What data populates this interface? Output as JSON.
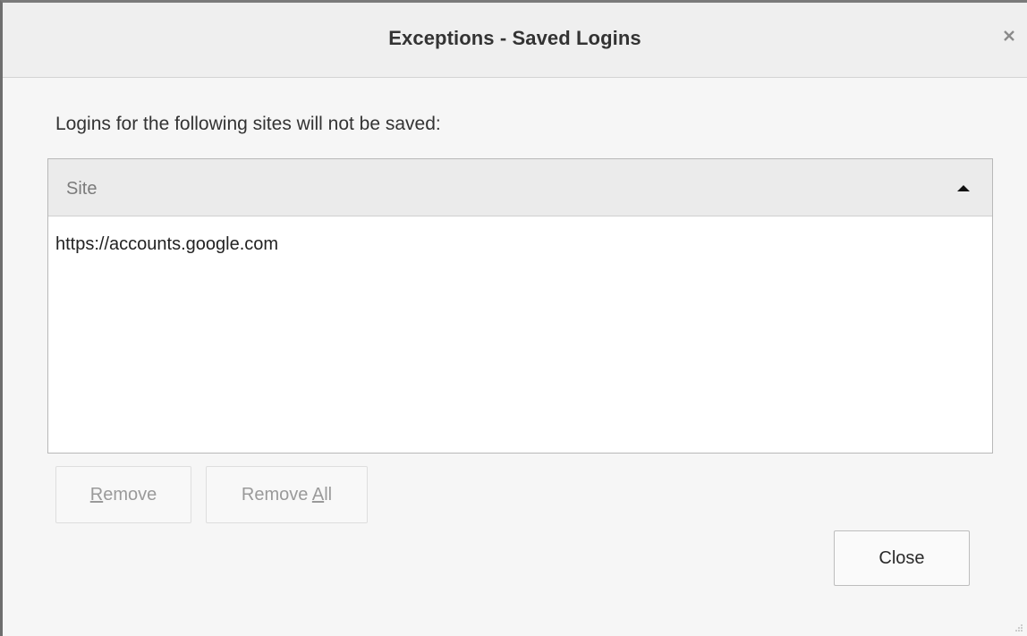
{
  "dialog": {
    "title": "Exceptions - Saved Logins",
    "close_glyph": "×",
    "intro": "Logins for the following sites will not be saved:"
  },
  "table": {
    "column_site": "Site",
    "sort_direction": "ascending",
    "rows": [
      {
        "site": "https://accounts.google.com"
      }
    ]
  },
  "buttons": {
    "remove": {
      "accesskey": "R",
      "rest": "emove",
      "enabled": false
    },
    "remove_all": {
      "prefix": "Remove ",
      "accesskey": "A",
      "rest": "ll",
      "enabled": false
    },
    "close": "Close"
  },
  "icons": {
    "close": "close-icon",
    "sort": "sort-ascending-icon",
    "resize": "resize-grip-icon"
  },
  "colors": {
    "titlebar_bg": "#efefef",
    "dialog_bg": "#f6f6f6",
    "header_bg": "#ebebeb",
    "disabled_text": "#9a9a9a"
  }
}
